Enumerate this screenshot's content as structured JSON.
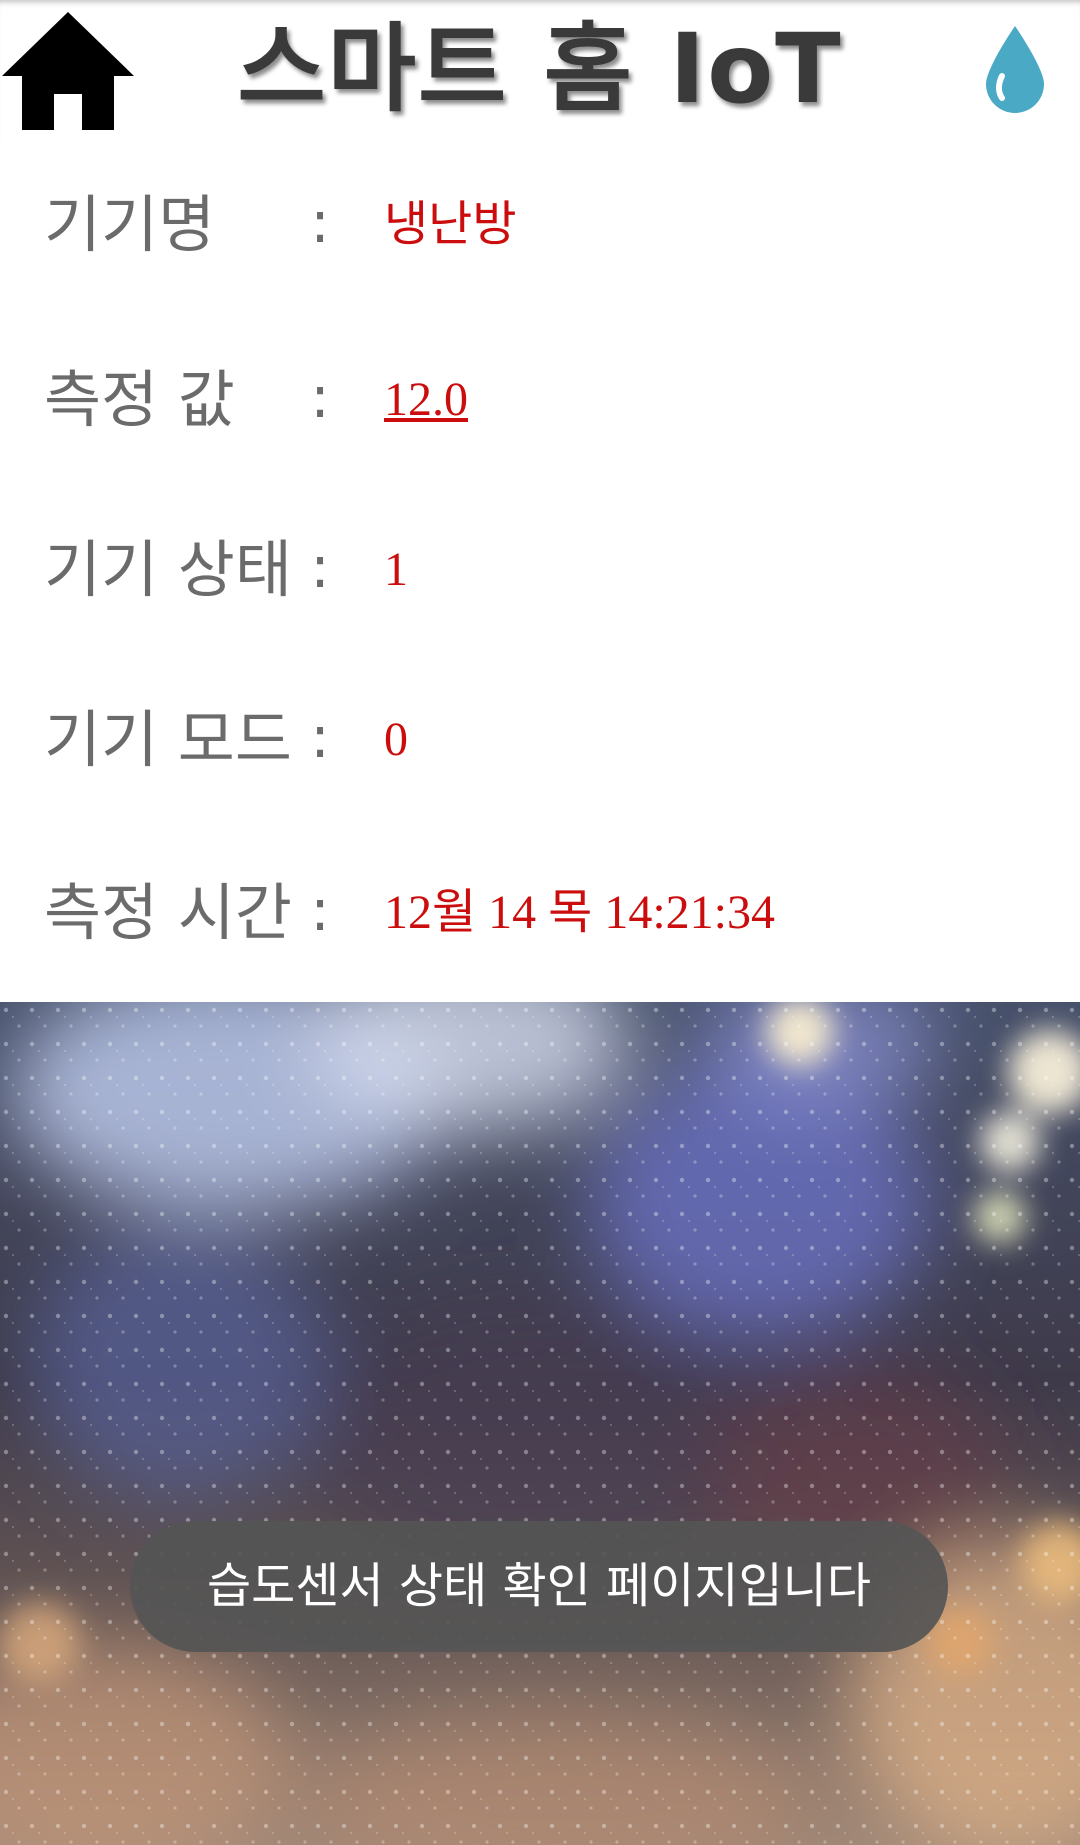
{
  "header": {
    "title": "스마트 홈 IoT",
    "home_icon": "home-icon",
    "drop_icon": "water-drop-icon"
  },
  "info": {
    "device_name": {
      "label": "기기명",
      "colon": ":",
      "value": "냉난방"
    },
    "measured_value": {
      "label": "측정 값",
      "colon": ":",
      "value": "12.0"
    },
    "device_status": {
      "label": "기기 상태",
      "colon": ":",
      "value": "1"
    },
    "device_mode": {
      "label": "기기 모드",
      "colon": ":",
      "value": "0"
    },
    "measured_time": {
      "label": "측정 시간",
      "colon": ":",
      "value": "12월 14 목 14:21:34"
    }
  },
  "toast": {
    "message": "습도센서 상태 확인 페이지입니다"
  },
  "colors": {
    "label_gray": "#6b6b6b",
    "value_red": "#cc0d0d",
    "title_dark": "#3a3a3a",
    "drop_teal": "#4aa9c4",
    "toast_bg": "#555555"
  }
}
